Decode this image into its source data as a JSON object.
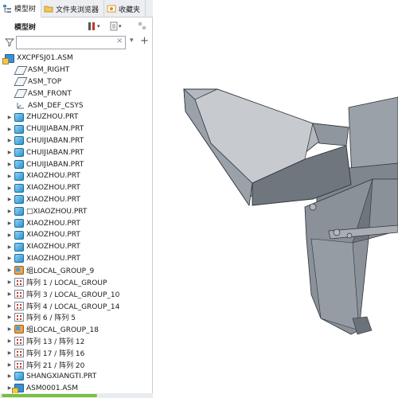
{
  "tabs": [
    {
      "label": "模型树",
      "icon": "model-tree-icon",
      "active": true
    },
    {
      "label": "文件夹浏览器",
      "icon": "folder-browser-icon",
      "active": false
    },
    {
      "label": "收藏夹",
      "icon": "favorites-icon",
      "active": false
    }
  ],
  "toolbar": {
    "tree_label": "模型树",
    "settings_icon": "tree-settings-icon",
    "show_icon": "show-menu-icon",
    "extra_icon": "tree-filter-icon"
  },
  "filter": {
    "value": "",
    "placeholder": "",
    "clear_glyph": "×",
    "add_glyph": "+"
  },
  "tree": {
    "root": {
      "label": "XXCPFSJ01.ASM",
      "icon": "assembly-icon"
    },
    "items": [
      {
        "label": "ASM_RIGHT",
        "icon": "datum-plane-icon",
        "kind": "plane",
        "expandable": false
      },
      {
        "label": "ASM_TOP",
        "icon": "datum-plane-icon",
        "kind": "plane",
        "expandable": false
      },
      {
        "label": "ASM_FRONT",
        "icon": "datum-plane-icon",
        "kind": "plane",
        "expandable": false
      },
      {
        "label": "ASM_DEF_CSYS",
        "icon": "coordinate-system-icon",
        "kind": "csys",
        "expandable": false
      },
      {
        "label": "ZHUZHOU.PRT",
        "icon": "part-icon",
        "kind": "prt",
        "expandable": true
      },
      {
        "label": "CHUIJIABAN.PRT",
        "icon": "part-icon",
        "kind": "prt",
        "expandable": true
      },
      {
        "label": "CHUIJIABAN.PRT",
        "icon": "part-icon",
        "kind": "prt",
        "expandable": true
      },
      {
        "label": "CHUIJIABAN.PRT",
        "icon": "part-icon",
        "kind": "prt",
        "expandable": true
      },
      {
        "label": "CHUIJIABAN.PRT",
        "icon": "part-icon",
        "kind": "prt",
        "expandable": true
      },
      {
        "label": "XIAOZHOU.PRT",
        "icon": "part-icon",
        "kind": "prt",
        "expandable": true
      },
      {
        "label": "XIAOZHOU.PRT",
        "icon": "part-icon",
        "kind": "prt",
        "expandable": true
      },
      {
        "label": "XIAOZHOU.PRT",
        "icon": "part-icon",
        "kind": "prt",
        "expandable": true
      },
      {
        "label": "□XIAOZHOU.PRT",
        "icon": "part-icon",
        "kind": "prt",
        "expandable": true
      },
      {
        "label": "XIAOZHOU.PRT",
        "icon": "part-icon",
        "kind": "prt",
        "expandable": true
      },
      {
        "label": "XIAOZHOU.PRT",
        "icon": "part-icon",
        "kind": "prt",
        "expandable": true
      },
      {
        "label": "XIAOZHOU.PRT",
        "icon": "part-icon",
        "kind": "prt",
        "expandable": true
      },
      {
        "label": "XIAOZHOU.PRT",
        "icon": "part-icon",
        "kind": "prt",
        "expandable": true
      },
      {
        "label": "组LOCAL_GROUP_9",
        "icon": "group-icon",
        "kind": "group",
        "expandable": true
      },
      {
        "label": "阵列 1 / LOCAL_GROUP",
        "icon": "pattern-icon",
        "kind": "pattern",
        "expandable": true
      },
      {
        "label": "阵列 3 / LOCAL_GROUP_10",
        "icon": "pattern-icon",
        "kind": "pattern",
        "expandable": true
      },
      {
        "label": "阵列 4 / LOCAL_GROUP_14",
        "icon": "pattern-icon",
        "kind": "pattern",
        "expandable": true
      },
      {
        "label": "阵列 6 / 阵列 5",
        "icon": "pattern-icon",
        "kind": "pattern",
        "expandable": true
      },
      {
        "label": "组LOCAL_GROUP_18",
        "icon": "group-icon",
        "kind": "group",
        "expandable": true
      },
      {
        "label": "阵列 13 / 阵列 12",
        "icon": "pattern-icon",
        "kind": "pattern",
        "expandable": true
      },
      {
        "label": "阵列 17 / 阵列 16",
        "icon": "pattern-icon",
        "kind": "pattern",
        "expandable": true
      },
      {
        "label": "阵列 21 / 阵列 20",
        "icon": "pattern-icon",
        "kind": "pattern",
        "expandable": true
      },
      {
        "label": "SHANGXIANGTI.PRT",
        "icon": "part-icon",
        "kind": "prt",
        "expandable": true
      },
      {
        "label": "ASM0001.ASM",
        "icon": "assembly-icon",
        "kind": "asm",
        "expandable": true
      }
    ]
  },
  "viewport": {
    "model_color": "#8c939b",
    "model_dark": "#5d646c",
    "model_light": "#b3b8be",
    "edge_color": "#2d3238"
  },
  "colors": {
    "panel_border": "#c8ccd2",
    "tab_bg": "#eceef1",
    "scroll_accent": "#7ac043"
  }
}
